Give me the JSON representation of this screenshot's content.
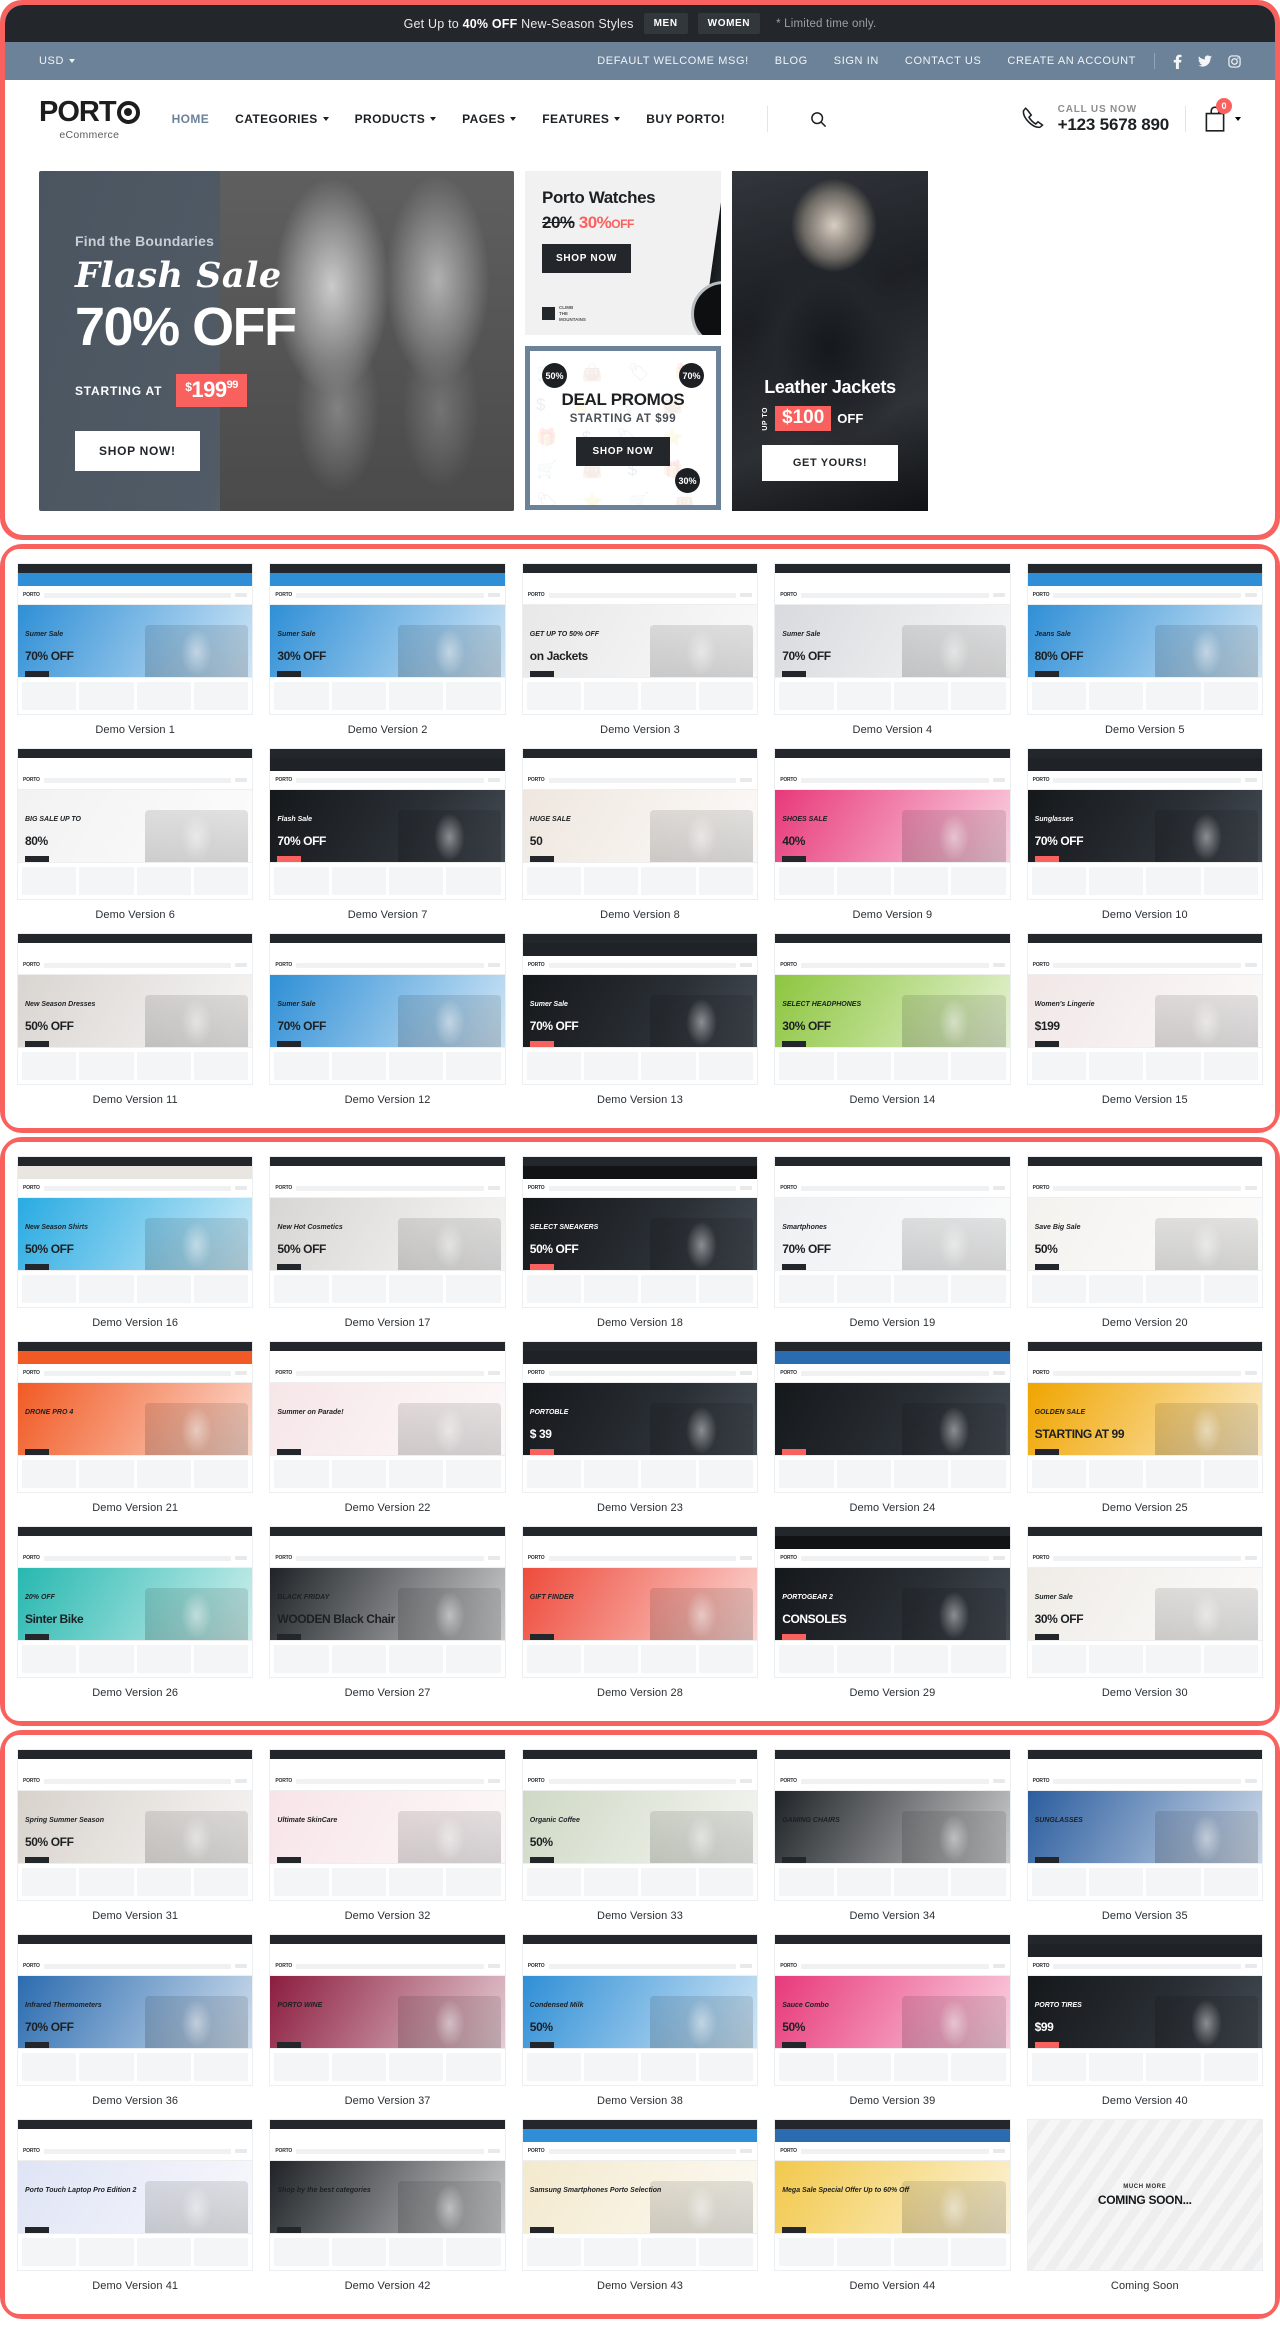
{
  "announcement": {
    "prefix": "Get Up to ",
    "highlight": "40% OFF",
    "suffix": " New-Season Styles",
    "men_label": "MEN",
    "women_label": "WOMEN",
    "note": "* Limited time only."
  },
  "topbar": {
    "currency": "USD",
    "links": [
      "DEFAULT WELCOME MSG!",
      "BLOG",
      "SIGN IN",
      "CONTACT US",
      "CREATE AN ACCOUNT"
    ],
    "social": [
      "facebook-icon",
      "twitter-icon",
      "instagram-icon"
    ]
  },
  "header": {
    "logo_word": "PORT",
    "logo_sub": "eCommerce",
    "nav": [
      {
        "label": "HOME",
        "caret": false,
        "active": true
      },
      {
        "label": "CATEGORIES",
        "caret": true,
        "active": false
      },
      {
        "label": "PRODUCTS",
        "caret": true,
        "active": false
      },
      {
        "label": "PAGES",
        "caret": true,
        "active": false
      },
      {
        "label": "FEATURES",
        "caret": true,
        "active": false
      },
      {
        "label": "BUY PORTO!",
        "caret": false,
        "active": false
      }
    ],
    "call_label": "CALL US NOW",
    "call_number": "+123 5678 890",
    "cart_count": "0"
  },
  "hero": {
    "main": {
      "kicker": "Find the Boundaries",
      "script": "Flash Sale",
      "big": "70% OFF",
      "starting_label": "STARTING AT",
      "price_currency": "$",
      "price_value": "199",
      "price_decimals": "99",
      "cta": "SHOP NOW!"
    },
    "watches": {
      "title": "Porto Watches",
      "old_discount": "20%",
      "new_discount": "30%",
      "off": "OFF",
      "cta": "SHOP NOW",
      "brand_line1": "CLIMB",
      "brand_line2": "THE",
      "brand_line3": "MOUNTAINS"
    },
    "promos": {
      "title": "DEAL PROMOS",
      "subtitle": "STARTING AT $99",
      "cta": "SHOP NOW",
      "badge_a": "50%",
      "badge_b": "70%",
      "badge_c": "30%",
      "bg_glyphs": "🛒 👜 🏷 🎁 $ ⭐ 🛒 👜 🎁 $ 🏷 ⭐ 🛒 👜 $ 🎁 🏷 ⭐ 🛒 👜 🎁 $ 🏷 ⭐ 🛒 👜 🎁 $"
    },
    "jackets": {
      "title": "Leather Jackets",
      "upto": "UP TO",
      "amount": "$100",
      "off": "OFF",
      "cta": "GET YOURS!"
    }
  },
  "demo_sections": [
    {
      "rows": [
        [
          {
            "label": "Demo Version 1",
            "accent": "#2f8fd6",
            "nav": "#2f8fd6",
            "hero_text": "Sumer Sale",
            "hero_big": "70% OFF",
            "style": "sidebar"
          },
          {
            "label": "Demo Version 2",
            "accent": "#2f8fd6",
            "nav": "#2f8fd6",
            "hero_text": "Sumer Sale",
            "hero_big": "30% OFF",
            "style": "sidebar"
          },
          {
            "label": "Demo Version 3",
            "accent": "#e8e8e8",
            "nav": "#ffffff",
            "hero_text": "GET UP TO 50% OFF",
            "hero_big": "on Jackets",
            "style": "light"
          },
          {
            "label": "Demo Version 4",
            "accent": "#d8dadd",
            "nav": "#ffffff",
            "hero_text": "Sumer Sale",
            "hero_big": "70% OFF",
            "style": "light"
          },
          {
            "label": "Demo Version 5",
            "accent": "#2f8fd6",
            "nav": "#2f8fd6",
            "hero_text": "Jeans Sale",
            "hero_big": "80% OFF",
            "style": "sidebar"
          }
        ],
        [
          {
            "label": "Demo Version 6",
            "accent": "#f2f2f2",
            "nav": "#ffffff",
            "hero_text": "BIG SALE UP TO",
            "hero_big": "80%",
            "style": "light"
          },
          {
            "label": "Demo Version 7",
            "accent": "#1f2327",
            "nav": "#1f2327",
            "hero_text": "Flash Sale",
            "hero_big": "70% OFF",
            "style": "dark"
          },
          {
            "label": "Demo Version 8",
            "accent": "#efe7df",
            "nav": "#ffffff",
            "hero_text": "HUGE SALE",
            "hero_big": "50",
            "style": "light"
          },
          {
            "label": "Demo Version 9",
            "accent": "#e8397a",
            "nav": "#ffffff",
            "hero_text": "SHOES SALE",
            "hero_big": "40%",
            "style": "light"
          },
          {
            "label": "Demo Version 10",
            "accent": "#1f2327",
            "nav": "#1f2327",
            "hero_text": "Sunglasses",
            "hero_big": "70% OFF",
            "style": "dark"
          }
        ],
        [
          {
            "label": "Demo Version 11",
            "accent": "#d9d5d1",
            "nav": "#ffffff",
            "hero_text": "New Season Dresses",
            "hero_big": "50% OFF",
            "style": "light"
          },
          {
            "label": "Demo Version 12",
            "accent": "#2f8fd6",
            "nav": "#ffffff",
            "hero_text": "Sumer Sale",
            "hero_big": "70% OFF",
            "style": "light"
          },
          {
            "label": "Demo Version 13",
            "accent": "#d9202b",
            "nav": "#1f2327",
            "hero_text": "Sumer Sale",
            "hero_big": "70% OFF",
            "style": "dark"
          },
          {
            "label": "Demo Version 14",
            "accent": "#8dc63f",
            "nav": "#ffffff",
            "hero_text": "SELECT HEADPHONES",
            "hero_big": "30% OFF",
            "style": "light"
          },
          {
            "label": "Demo Version 15",
            "accent": "#f1e7e7",
            "nav": "#ffffff",
            "hero_text": "Women's Lingerie",
            "hero_big": "$199",
            "style": "light"
          }
        ]
      ]
    },
    {
      "rows": [
        [
          {
            "label": "Demo Version 16",
            "accent": "#29abe2",
            "nav": "#e9e5e1",
            "hero_text": "New Season Shirts",
            "hero_big": "50% OFF",
            "style": "light"
          },
          {
            "label": "Demo Version 17",
            "accent": "#d8d6d4",
            "nav": "#ffffff",
            "hero_text": "New Hot Cosmetics",
            "hero_big": "50% OFF",
            "style": "light"
          },
          {
            "label": "Demo Version 18",
            "accent": "#111315",
            "nav": "#111315",
            "hero_text": "SELECT SNEAKERS",
            "hero_big": "50% OFF",
            "style": "dark"
          },
          {
            "label": "Demo Version 19",
            "accent": "#eef0f2",
            "nav": "#ffffff",
            "hero_text": "Smartphones",
            "hero_big": "70% OFF",
            "style": "light"
          },
          {
            "label": "Demo Version 20",
            "accent": "#f4f2ef",
            "nav": "#ffffff",
            "hero_text": "Save Big Sale",
            "hero_big": "50%",
            "style": "light"
          }
        ],
        [
          {
            "label": "Demo Version 21",
            "accent": "#f15a24",
            "nav": "#f15a24",
            "hero_text": "DRONE PRO 4",
            "hero_big": "",
            "style": "light"
          },
          {
            "label": "Demo Version 22",
            "accent": "#f6e6e8",
            "nav": "#ffffff",
            "hero_text": "Summer on Parade!",
            "hero_big": "",
            "style": "light"
          },
          {
            "label": "Demo Version 23",
            "accent": "#ee4b3b",
            "nav": "#1f2327",
            "hero_text": "PORTOBLE",
            "hero_big": "$ 39",
            "style": "dark"
          },
          {
            "label": "Demo Version 24",
            "accent": "#2b6cb0",
            "nav": "#2b6cb0",
            "hero_text": "",
            "hero_big": "",
            "style": "dark"
          },
          {
            "label": "Demo Version 25",
            "accent": "#f0a500",
            "nav": "#ffffff",
            "hero_text": "GOLDEN SALE",
            "hero_big": "STARTING AT 99",
            "style": "light"
          }
        ],
        [
          {
            "label": "Demo Version 26",
            "accent": "#27b8b0",
            "nav": "#ffffff",
            "hero_text": "20% OFF",
            "hero_big": "Sinter Bike",
            "style": "light"
          },
          {
            "label": "Demo Version 27",
            "accent": "#1f2327",
            "nav": "#ffffff",
            "hero_text": "BLACK FRIDAY",
            "hero_big": "WOODEN Black Chair",
            "style": "light"
          },
          {
            "label": "Demo Version 28",
            "accent": "#ee4b3b",
            "nav": "#ffffff",
            "hero_text": "GIFT FINDER",
            "hero_big": "",
            "style": "light"
          },
          {
            "label": "Demo Version 29",
            "accent": "#0b5cab",
            "nav": "#111315",
            "hero_text": "PORTOGEAR 2",
            "hero_big": "CONSOLES",
            "style": "dark"
          },
          {
            "label": "Demo Version 30",
            "accent": "#efece7",
            "nav": "#ffffff",
            "hero_text": "Sumer Sale",
            "hero_big": "30% OFF",
            "style": "light"
          }
        ]
      ]
    },
    {
      "rows": [
        [
          {
            "label": "Demo Version 31",
            "accent": "#d8d2cc",
            "nav": "#ffffff",
            "hero_text": "Spring Summer Season",
            "hero_big": "50% OFF",
            "style": "light"
          },
          {
            "label": "Demo Version 32",
            "accent": "#f7e4e8",
            "nav": "#ffffff",
            "hero_text": "Ultimate SkinCare",
            "hero_big": "",
            "style": "light"
          },
          {
            "label": "Demo Version 33",
            "accent": "#cfd8c5",
            "nav": "#ffffff",
            "hero_text": "Organic Coffee",
            "hero_big": "50%",
            "style": "light"
          },
          {
            "label": "Demo Version 34",
            "accent": "#1f2327",
            "nav": "#ffffff",
            "hero_text": "GAMING CHAIRS",
            "hero_big": "",
            "style": "light"
          },
          {
            "label": "Demo Version 35",
            "accent": "#2b5d9e",
            "nav": "#ffffff",
            "hero_text": "SUNGLASSES",
            "hero_big": "",
            "style": "light"
          }
        ],
        [
          {
            "label": "Demo Version 36",
            "accent": "#2b6cb0",
            "nav": "#ffffff",
            "hero_text": "Infrared Thermometers",
            "hero_big": "70% OFF",
            "style": "light"
          },
          {
            "label": "Demo Version 37",
            "accent": "#8c1d3f",
            "nav": "#ffffff",
            "hero_text": "PORTO WINE",
            "hero_big": "",
            "style": "light"
          },
          {
            "label": "Demo Version 38",
            "accent": "#2f8fd6",
            "nav": "#ffffff",
            "hero_text": "Condensed Milk",
            "hero_big": "50%",
            "style": "light"
          },
          {
            "label": "Demo Version 39",
            "accent": "#e8397a",
            "nav": "#ffffff",
            "hero_text": "Sauce Combo",
            "hero_big": "50%",
            "style": "light"
          },
          {
            "label": "Demo Version 40",
            "accent": "#1f2327",
            "nav": "#1f2327",
            "hero_text": "PORTO TIRES",
            "hero_big": "$99",
            "style": "dark"
          }
        ],
        [
          {
            "label": "Demo Version 41",
            "accent": "#dfe4f5",
            "nav": "#ffffff",
            "hero_text": "Porto Touch Laptop Pro Edition 2",
            "hero_big": "",
            "style": "light"
          },
          {
            "label": "Demo Version 42",
            "accent": "#1f2327",
            "nav": "#ffffff",
            "hero_text": "Shop by the best categories",
            "hero_big": "",
            "style": "light"
          },
          {
            "label": "Demo Version 43",
            "accent": "#f3e9cd",
            "nav": "#2f8fd6",
            "hero_text": "Samsung Smartphones Porto Selection",
            "hero_big": "",
            "style": "light"
          },
          {
            "label": "Demo Version 44",
            "accent": "#f2c94c",
            "nav": "#2b6cb0",
            "hero_text": "Mega Sale Special Offer Up to 60% Off",
            "hero_big": "",
            "style": "light"
          },
          {
            "label": "Coming Soon",
            "accent": "#f4f4f4",
            "nav": "#f4f4f4",
            "hero_text": "MUCH MORE",
            "hero_big": "COMING SOON...",
            "style": "soon"
          }
        ]
      ]
    }
  ]
}
